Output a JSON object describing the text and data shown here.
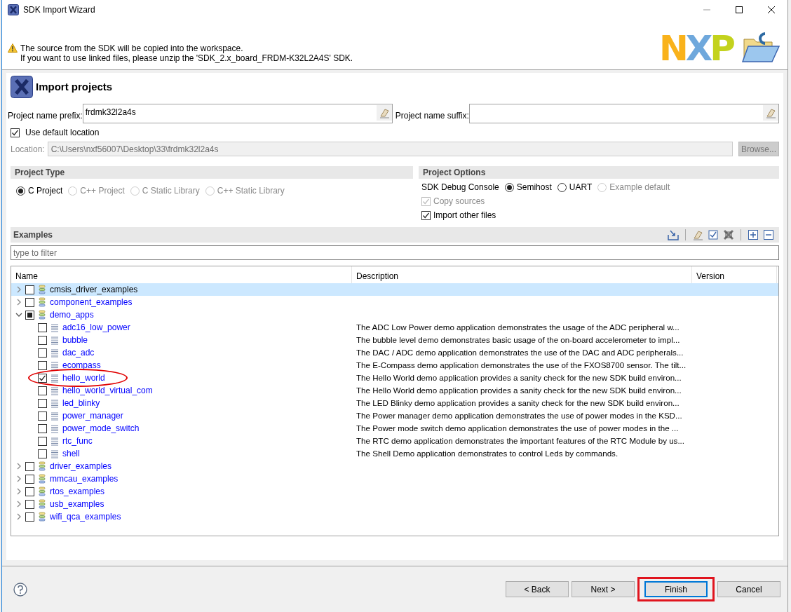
{
  "window": {
    "title": "SDK Import Wizard"
  },
  "notice": {
    "lines": [
      "The source from the SDK will be copied into the workspace.",
      "If you want to use linked files, please unzip the 'SDK_2.x_board_FRDM-K32L2A4S' SDK."
    ]
  },
  "brand_logo": "NXP",
  "page_title": "Import projects",
  "prefix": {
    "label": "Project name prefix:",
    "value": "frdmk32l2a4s"
  },
  "suffix": {
    "label": "Project name suffix:"
  },
  "use_default_location": {
    "label": "Use default location",
    "checked": true
  },
  "location": {
    "label": "Location:",
    "value": "C:\\Users\\nxf56007\\Desktop\\33\\frdmk32l2a4s",
    "disabled": true
  },
  "browse_button": {
    "label": "Browse...",
    "disabled": true
  },
  "project_type": {
    "title": "Project Type",
    "options": [
      {
        "label": "C Project",
        "selected": true,
        "disabled": false
      },
      {
        "label": "C++ Project",
        "selected": false,
        "disabled": true
      },
      {
        "label": "C Static Library",
        "selected": false,
        "disabled": true
      },
      {
        "label": "C++ Static Library",
        "selected": false,
        "disabled": true
      }
    ]
  },
  "project_options": {
    "title": "Project Options",
    "console_label": "SDK Debug Console",
    "console_options": [
      {
        "label": "Semihost",
        "selected": true,
        "disabled": false
      },
      {
        "label": "UART",
        "selected": false,
        "disabled": false
      },
      {
        "label": "Example default",
        "selected": false,
        "disabled": true
      }
    ],
    "checkboxes": [
      {
        "label": "Copy sources",
        "checked": true,
        "disabled": true
      },
      {
        "label": "Import other files",
        "checked": true,
        "disabled": false
      }
    ]
  },
  "examples": {
    "title": "Examples",
    "filter": {
      "placeholder": "type to filter"
    },
    "columns": [
      "Name",
      "Description",
      "Version"
    ],
    "tree": [
      {
        "kind": "group",
        "name": "cmsis_driver_examples",
        "checked": false,
        "partial": false,
        "expanded": false,
        "selected": true
      },
      {
        "kind": "group",
        "name": "component_examples",
        "checked": false,
        "partial": false,
        "expanded": false,
        "selected": false
      },
      {
        "kind": "group",
        "name": "demo_apps",
        "checked": false,
        "partial": true,
        "expanded": true,
        "selected": false,
        "children": [
          {
            "kind": "example",
            "name": "adc16_low_power",
            "description": "The ADC Low Power demo application demonstrates the usage of the ADC peripheral w...",
            "checked": false,
            "selected": false,
            "circled": false
          },
          {
            "kind": "example",
            "name": "bubble",
            "description": "The bubble level demo demonstrates basic usage of the on-board accelerometer to impl...",
            "checked": false,
            "selected": false,
            "circled": false
          },
          {
            "kind": "example",
            "name": "dac_adc",
            "description": "The DAC / ADC demo application demonstrates the use of the DAC and ADC peripherals...",
            "checked": false,
            "selected": false,
            "circled": false
          },
          {
            "kind": "example",
            "name": "ecompass",
            "description": "The E-Compass demo application demonstrates the use of the FXOS8700 sensor. The tilt...",
            "checked": false,
            "selected": false,
            "circled": false
          },
          {
            "kind": "example",
            "name": "hello_world",
            "description": "The Hello World demo application provides a sanity check for the new SDK build environ...",
            "checked": true,
            "selected": false,
            "circled": true
          },
          {
            "kind": "example",
            "name": "hello_world_virtual_com",
            "description": "The Hello World demo application provides a sanity check for the new SDK build environ...",
            "checked": false,
            "selected": false,
            "circled": false
          },
          {
            "kind": "example",
            "name": "led_blinky",
            "description": "The LED Blinky demo application provides a sanity check for the new SDK build environ...",
            "checked": false,
            "selected": false,
            "circled": false
          },
          {
            "kind": "example",
            "name": "power_manager",
            "description": "The Power manager demo application demonstrates the use of power modes in the KSD...",
            "checked": false,
            "selected": false,
            "circled": false
          },
          {
            "kind": "example",
            "name": "power_mode_switch",
            "description": "The Power mode switch demo application demonstrates the use of power modes in the ...",
            "checked": false,
            "selected": false,
            "circled": false
          },
          {
            "kind": "example",
            "name": "rtc_func",
            "description": "The RTC demo application demonstrates the important features of the RTC Module by us...",
            "checked": false,
            "selected": false,
            "circled": false
          },
          {
            "kind": "example",
            "name": "shell",
            "description": "The Shell Demo application demonstrates to control Leds by commands.",
            "checked": false,
            "selected": false,
            "circled": false
          }
        ]
      },
      {
        "kind": "group",
        "name": "driver_examples",
        "checked": false,
        "partial": false,
        "expanded": false,
        "selected": false
      },
      {
        "kind": "group",
        "name": "mmcau_examples",
        "checked": false,
        "partial": false,
        "expanded": false,
        "selected": false
      },
      {
        "kind": "group",
        "name": "rtos_examples",
        "checked": false,
        "partial": false,
        "expanded": false,
        "selected": false
      },
      {
        "kind": "group",
        "name": "usb_examples",
        "checked": false,
        "partial": false,
        "expanded": false,
        "selected": false
      },
      {
        "kind": "group",
        "name": "wifi_qca_examples",
        "checked": false,
        "partial": false,
        "expanded": false,
        "selected": false
      }
    ]
  },
  "buttons": [
    {
      "label": "< Back",
      "default": false,
      "circled": false
    },
    {
      "label": "Next >",
      "default": false,
      "circled": false
    },
    {
      "label": "Finish",
      "default": true,
      "circled": true
    },
    {
      "label": "Cancel",
      "default": false,
      "circled": false
    }
  ]
}
